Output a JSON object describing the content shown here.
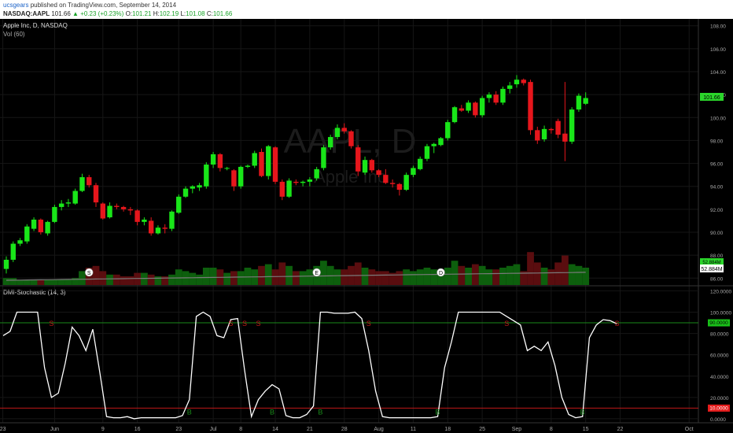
{
  "header": {
    "user": "ucsgears",
    "published": "published on TradingView.com, September 14, 2014",
    "symbol": "NASDAQ:AAPL",
    "last": "101.66",
    "change": "▲ +0.23 (+0.23%)",
    "o_key": "O:",
    "o_val": "101.21",
    "h_key": "H:",
    "h_val": "102.19",
    "l_key": "L:",
    "l_val": "101.08",
    "c_key": "C:",
    "c_val": "101.66"
  },
  "price_pane": {
    "title": "Apple Inc, D, NASDAQ",
    "volume_label": "Vol (60)",
    "watermark_symbol": "AAPL, D",
    "watermark_name": "Apple Inc",
    "last_price_tag": "101.66",
    "volume_tag": "52.884M",
    "volume_tag_top": "52.884M"
  },
  "osc_pane": {
    "title": "DMI-Stochastic (14, 3)",
    "upper_level_tag": "90.0000",
    "lower_level_tag": "10.0000"
  },
  "colors": {
    "up": "#19e619",
    "down": "#e6161c",
    "vol_up": "#0d5f0d",
    "vol_down": "#5a0d0f",
    "upper_line": "#1a8a1a",
    "lower_line": "#c01818",
    "osc_line": "#ffffff"
  },
  "chart_data": [
    {
      "type": "candlestick",
      "title": "Apple Inc, D, NASDAQ",
      "price_axis_ticks": [
        "108.00",
        "106.00",
        "104.00",
        "102.00",
        "100.00",
        "98.00",
        "96.00",
        "94.00",
        "92.00",
        "90.00",
        "88.00",
        "86.00"
      ],
      "ylim": [
        85.4,
        108.6
      ],
      "time_axis_ticks": [
        "23",
        "Jun",
        "9",
        "16",
        "23",
        "Jul",
        "8",
        "14",
        "21",
        "28",
        "Aug",
        "11",
        "18",
        "25",
        "Sep",
        "8",
        "15",
        "22",
        "Oct"
      ],
      "candles": [
        {
          "o": 86.8,
          "h": 87.9,
          "l": 86.4,
          "c": 87.6
        },
        {
          "o": 87.6,
          "h": 89.2,
          "l": 87.4,
          "c": 89.0
        },
        {
          "o": 89.0,
          "h": 89.5,
          "l": 88.8,
          "c": 89.3
        },
        {
          "o": 89.2,
          "h": 90.7,
          "l": 89.0,
          "c": 90.5
        },
        {
          "o": 90.3,
          "h": 91.3,
          "l": 90.1,
          "c": 91.1
        },
        {
          "o": 91.1,
          "h": 91.2,
          "l": 89.8,
          "c": 90.0
        },
        {
          "o": 89.9,
          "h": 91.0,
          "l": 89.7,
          "c": 90.9
        },
        {
          "o": 90.9,
          "h": 92.4,
          "l": 90.8,
          "c": 92.2
        },
        {
          "o": 92.2,
          "h": 92.8,
          "l": 91.9,
          "c": 92.5
        },
        {
          "o": 92.5,
          "h": 92.9,
          "l": 92.2,
          "c": 92.6
        },
        {
          "o": 92.5,
          "h": 93.8,
          "l": 92.4,
          "c": 93.6
        },
        {
          "o": 93.6,
          "h": 95.1,
          "l": 93.5,
          "c": 94.8
        },
        {
          "o": 94.8,
          "h": 95.0,
          "l": 93.9,
          "c": 94.1
        },
        {
          "o": 94.1,
          "h": 94.3,
          "l": 92.2,
          "c": 92.6
        },
        {
          "o": 92.5,
          "h": 92.6,
          "l": 91.1,
          "c": 91.2
        },
        {
          "o": 91.3,
          "h": 92.6,
          "l": 91.2,
          "c": 92.3
        },
        {
          "o": 92.3,
          "h": 92.5,
          "l": 92.0,
          "c": 92.2
        },
        {
          "o": 92.2,
          "h": 92.3,
          "l": 91.8,
          "c": 92.0
        },
        {
          "o": 92.0,
          "h": 92.2,
          "l": 91.5,
          "c": 91.9
        },
        {
          "o": 91.9,
          "h": 92.0,
          "l": 90.6,
          "c": 90.9
        },
        {
          "o": 90.9,
          "h": 91.3,
          "l": 90.6,
          "c": 91.1
        },
        {
          "o": 91.0,
          "h": 91.3,
          "l": 89.7,
          "c": 89.9
        },
        {
          "o": 89.9,
          "h": 90.6,
          "l": 89.8,
          "c": 90.4
        },
        {
          "o": 90.4,
          "h": 90.7,
          "l": 89.9,
          "c": 90.3
        },
        {
          "o": 90.3,
          "h": 91.9,
          "l": 90.1,
          "c": 91.8
        },
        {
          "o": 91.7,
          "h": 93.3,
          "l": 91.6,
          "c": 93.1
        },
        {
          "o": 93.1,
          "h": 94.0,
          "l": 93.0,
          "c": 93.8
        },
        {
          "o": 93.8,
          "h": 94.1,
          "l": 93.4,
          "c": 94.0
        },
        {
          "o": 93.9,
          "h": 94.3,
          "l": 93.6,
          "c": 94.1
        },
        {
          "o": 94.0,
          "h": 96.1,
          "l": 93.8,
          "c": 95.9
        },
        {
          "o": 95.9,
          "h": 97.0,
          "l": 95.6,
          "c": 96.8
        },
        {
          "o": 96.8,
          "h": 96.9,
          "l": 95.3,
          "c": 95.6
        },
        {
          "o": 95.6,
          "h": 95.7,
          "l": 95.4,
          "c": 95.6
        },
        {
          "o": 95.4,
          "h": 95.5,
          "l": 93.6,
          "c": 94.0
        },
        {
          "o": 94.0,
          "h": 95.8,
          "l": 93.8,
          "c": 95.7
        },
        {
          "o": 95.7,
          "h": 95.9,
          "l": 95.6,
          "c": 95.8
        },
        {
          "o": 95.8,
          "h": 97.1,
          "l": 95.6,
          "c": 96.9
        },
        {
          "o": 97.0,
          "h": 97.3,
          "l": 94.8,
          "c": 94.9
        },
        {
          "o": 94.9,
          "h": 97.6,
          "l": 94.6,
          "c": 97.5
        },
        {
          "o": 97.4,
          "h": 97.5,
          "l": 94.2,
          "c": 94.4
        },
        {
          "o": 94.4,
          "h": 94.6,
          "l": 92.8,
          "c": 93.1
        },
        {
          "o": 93.1,
          "h": 94.7,
          "l": 93.0,
          "c": 94.5
        },
        {
          "o": 94.4,
          "h": 94.6,
          "l": 94.1,
          "c": 94.3
        },
        {
          "o": 94.3,
          "h": 94.5,
          "l": 94.0,
          "c": 94.4
        },
        {
          "o": 94.4,
          "h": 94.8,
          "l": 94.0,
          "c": 94.6
        },
        {
          "o": 94.7,
          "h": 95.7,
          "l": 94.5,
          "c": 95.5
        },
        {
          "o": 95.6,
          "h": 97.6,
          "l": 95.4,
          "c": 97.4
        },
        {
          "o": 97.4,
          "h": 98.5,
          "l": 97.2,
          "c": 98.3
        },
        {
          "o": 98.3,
          "h": 99.4,
          "l": 98.1,
          "c": 99.1
        },
        {
          "o": 99.1,
          "h": 99.5,
          "l": 98.6,
          "c": 98.8
        },
        {
          "o": 98.8,
          "h": 98.9,
          "l": 97.3,
          "c": 97.5
        },
        {
          "o": 97.4,
          "h": 97.6,
          "l": 94.9,
          "c": 95.3
        },
        {
          "o": 95.2,
          "h": 96.6,
          "l": 95.0,
          "c": 96.3
        },
        {
          "o": 96.3,
          "h": 96.4,
          "l": 95.2,
          "c": 95.4
        },
        {
          "o": 95.4,
          "h": 95.5,
          "l": 94.8,
          "c": 95.0
        },
        {
          "o": 95.0,
          "h": 95.5,
          "l": 94.2,
          "c": 94.3
        },
        {
          "o": 94.3,
          "h": 94.6,
          "l": 93.9,
          "c": 94.2
        },
        {
          "o": 94.2,
          "h": 94.3,
          "l": 93.2,
          "c": 93.7
        },
        {
          "o": 93.7,
          "h": 95.2,
          "l": 93.6,
          "c": 95.0
        },
        {
          "o": 95.0,
          "h": 95.8,
          "l": 94.8,
          "c": 95.6
        },
        {
          "o": 95.5,
          "h": 96.6,
          "l": 95.4,
          "c": 96.4
        },
        {
          "o": 96.4,
          "h": 97.7,
          "l": 96.2,
          "c": 97.5
        },
        {
          "o": 97.5,
          "h": 97.8,
          "l": 96.9,
          "c": 97.7
        },
        {
          "o": 97.6,
          "h": 98.3,
          "l": 97.5,
          "c": 98.2
        },
        {
          "o": 98.2,
          "h": 99.8,
          "l": 98.0,
          "c": 99.6
        },
        {
          "o": 99.6,
          "h": 101.0,
          "l": 99.5,
          "c": 100.9
        },
        {
          "o": 100.8,
          "h": 101.1,
          "l": 100.5,
          "c": 100.6
        },
        {
          "o": 100.6,
          "h": 101.5,
          "l": 100.4,
          "c": 101.3
        },
        {
          "o": 101.3,
          "h": 101.4,
          "l": 100.0,
          "c": 100.2
        },
        {
          "o": 100.2,
          "h": 101.9,
          "l": 100.0,
          "c": 101.7
        },
        {
          "o": 101.7,
          "h": 102.2,
          "l": 101.3,
          "c": 102.0
        },
        {
          "o": 102.0,
          "h": 102.3,
          "l": 101.1,
          "c": 101.3
        },
        {
          "o": 101.3,
          "h": 102.7,
          "l": 101.1,
          "c": 102.5
        },
        {
          "o": 102.5,
          "h": 103.1,
          "l": 102.1,
          "c": 102.8
        },
        {
          "o": 102.9,
          "h": 103.7,
          "l": 102.6,
          "c": 103.3
        },
        {
          "o": 103.3,
          "h": 103.4,
          "l": 102.8,
          "c": 103.0
        },
        {
          "o": 103.1,
          "h": 103.3,
          "l": 98.5,
          "c": 98.9
        },
        {
          "o": 98.9,
          "h": 99.2,
          "l": 97.7,
          "c": 98.0
        },
        {
          "o": 98.1,
          "h": 99.3,
          "l": 97.9,
          "c": 99.0
        },
        {
          "o": 99.0,
          "h": 99.1,
          "l": 98.6,
          "c": 98.9
        },
        {
          "o": 99.7,
          "h": 99.9,
          "l": 98.2,
          "c": 98.5
        },
        {
          "o": 98.6,
          "h": 103.1,
          "l": 96.2,
          "c": 97.9
        },
        {
          "o": 97.9,
          "h": 100.9,
          "l": 97.7,
          "c": 100.7
        },
        {
          "o": 100.7,
          "h": 102.1,
          "l": 100.5,
          "c": 101.9
        },
        {
          "o": 101.2,
          "h": 102.2,
          "l": 101.1,
          "c": 101.7
        }
      ],
      "volume_markers": [
        {
          "label": "S",
          "index": 12
        },
        {
          "label": "E",
          "index": 45
        },
        {
          "label": "D",
          "index": 63
        }
      ]
    },
    {
      "type": "line",
      "title": "DMI-Stochastic (14, 3)",
      "ylim": [
        -3,
        124
      ],
      "y_ticks": [
        "120.0000",
        "100.0000",
        "80.0000",
        "60.0000",
        "40.0000",
        "20.0000",
        "0.0000"
      ],
      "levels": [
        90,
        10
      ],
      "values": [
        78,
        82,
        100,
        100,
        100,
        100,
        48,
        20,
        24,
        52,
        86,
        78,
        64,
        84,
        44,
        2,
        1,
        1,
        2,
        0,
        1,
        1,
        1,
        1,
        1,
        1,
        3,
        18,
        96,
        100,
        96,
        78,
        76,
        93,
        94,
        46,
        2,
        18,
        26,
        32,
        28,
        3,
        1,
        1,
        4,
        12,
        100,
        100,
        99,
        99,
        99,
        100,
        94,
        64,
        26,
        2,
        1,
        1,
        1,
        1,
        1,
        1,
        1,
        2,
        48,
        72,
        100,
        100,
        100,
        100,
        100,
        100,
        100,
        96,
        92,
        88,
        64,
        68,
        64,
        72,
        50,
        20,
        4,
        1,
        2,
        76,
        88,
        93,
        92,
        89
      ],
      "markers": [
        {
          "label": "S",
          "index": 7
        },
        {
          "label": "S",
          "index": 33
        },
        {
          "label": "S",
          "index": 35
        },
        {
          "label": "S",
          "index": 37
        },
        {
          "label": "B",
          "index": 27
        },
        {
          "label": "B",
          "index": 39
        },
        {
          "label": "B",
          "index": 46
        },
        {
          "label": "S",
          "index": 53
        },
        {
          "label": "B",
          "index": 63
        },
        {
          "label": "S",
          "index": 73
        },
        {
          "label": "S",
          "index": 89
        },
        {
          "label": "B",
          "index": 84
        }
      ]
    }
  ]
}
